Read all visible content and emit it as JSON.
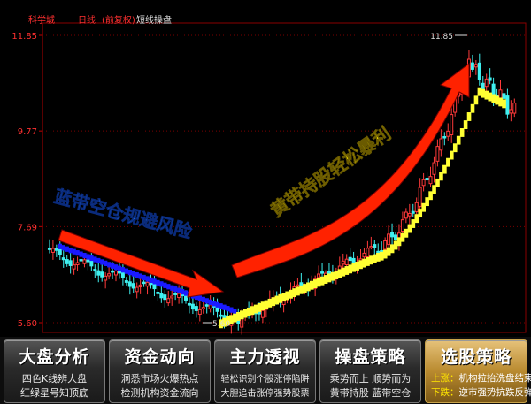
{
  "header": {
    "stock_name": "科学城",
    "period": "日线",
    "adjust": "(前复权)",
    "indicator": "短线操盘"
  },
  "axis": {
    "y_ticks": [
      "11.85",
      "9.77",
      "7.69",
      "5.60"
    ],
    "high_marker": "11.85",
    "low_marker": "5.60"
  },
  "annotations": {
    "blue_text": "蓝带空仓规避风险",
    "yellow_text": "黄带持股轻松暴利"
  },
  "bottom_panels": [
    {
      "title": "大盘分析",
      "line1": "四色K线辨大盘",
      "line2": "红绿星号知顶底"
    },
    {
      "title": "资金动向",
      "line1": "洞悉市场火爆热点",
      "line2": "检测机构资金流向"
    },
    {
      "title": "主力透视",
      "line1": "轻松识别个股涨停陷阱",
      "line2": "大胆追击涨停强势股票"
    },
    {
      "title": "操盘策略",
      "line1": "乘势而上  顺势而为",
      "line2": "黄带持股  蓝带空仓"
    },
    {
      "title": "选股策略",
      "line1_label": "上涨：",
      "line1": "机构拉抬洗盘结束",
      "line2_label": "下跌：",
      "line2": "逆市强势抗跌反弹"
    }
  ],
  "colors": {
    "up": "#ff3a3a",
    "down": "#3ff0f0",
    "blue_band": "#1a1aff",
    "yellow_band": "#ffff33",
    "arrow": "#ff2200",
    "blue_label": "#1e7bff",
    "yellow_label": "#ffee00"
  },
  "chart_data": {
    "type": "candlestick",
    "ylim": [
      5.6,
      11.85
    ],
    "y_ticks": [
      5.6,
      7.69,
      9.77,
      11.85
    ],
    "segments": [
      {
        "band": "blue",
        "trend": "down",
        "from": 7.2,
        "to": 5.6
      },
      {
        "band": "yellow",
        "trend": "up",
        "from": 5.6,
        "to": 11.85
      }
    ]
  }
}
